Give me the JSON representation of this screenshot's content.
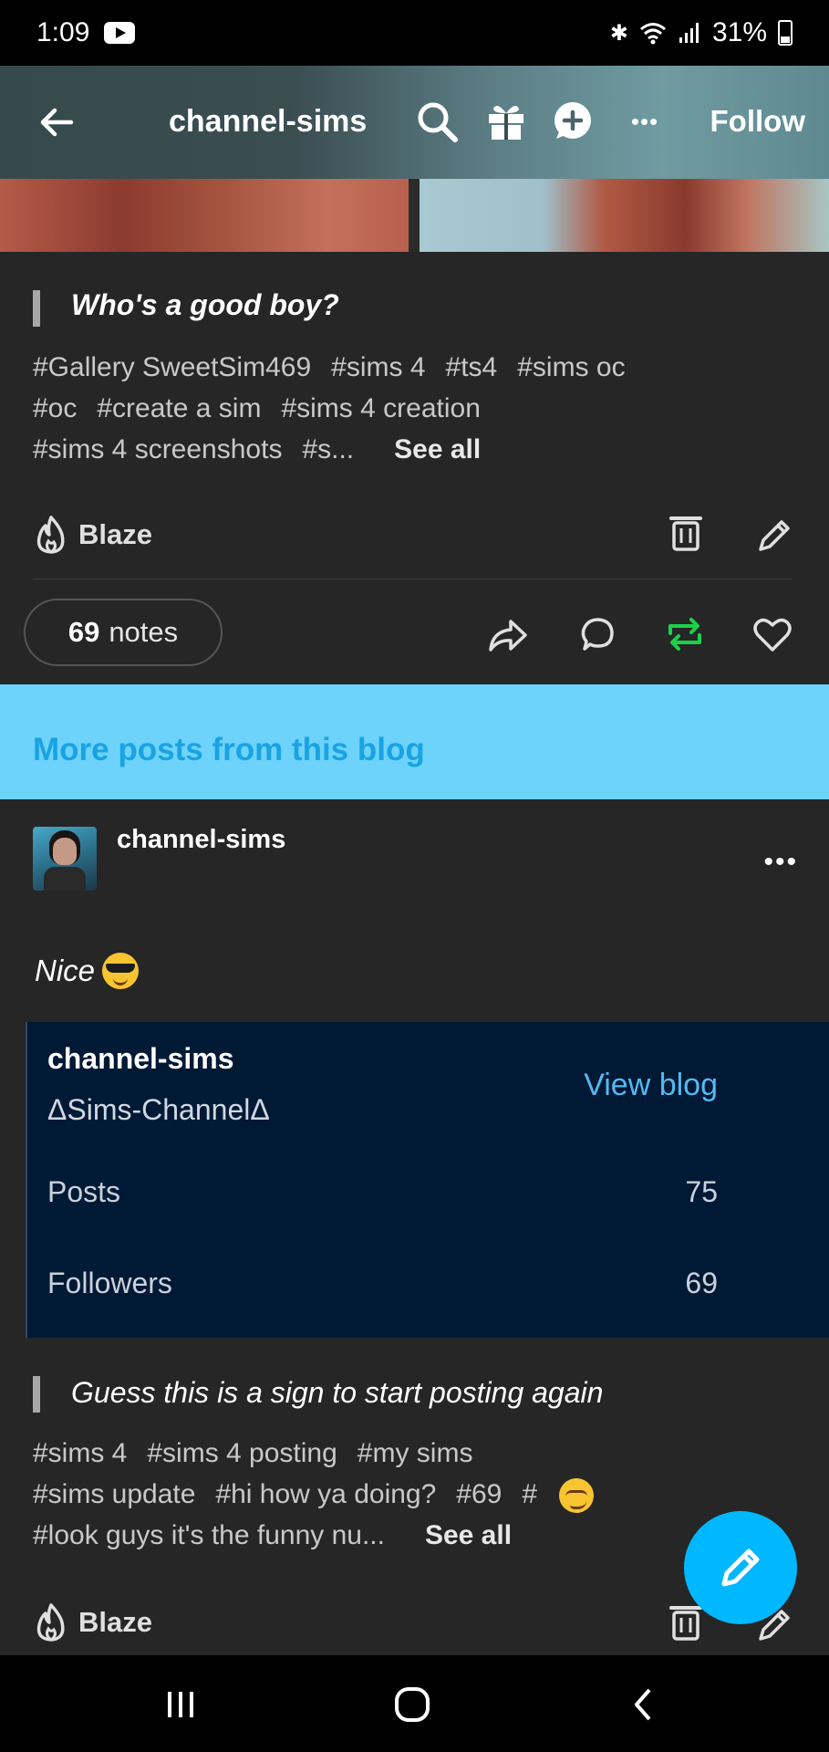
{
  "status_bar": {
    "time": "1:09",
    "battery": "31%"
  },
  "header": {
    "blog_name": "channel-sims",
    "follow_label": "Follow",
    "more_label": "•••"
  },
  "post": {
    "quote": "Who's a good boy?",
    "tags": [
      "#Gallery SweetSim469",
      "#sims 4",
      "#ts4",
      "#sims oc",
      "#oc",
      "#create a sim",
      "#sims 4 creation",
      "#sims 4 screenshots",
      "#s..."
    ],
    "see_all": "See all",
    "blaze_label": "Blaze",
    "notes_count": "69",
    "notes_label": "notes"
  },
  "more_posts_banner": "More posts from this blog",
  "post2": {
    "author": "channel-sims",
    "more_label": "•••",
    "text": "Nice",
    "blog_card": {
      "name": "channel-sims",
      "title": "ΔSims-ChannelΔ",
      "view_blog_label": "View blog",
      "posts_label": "Posts",
      "posts_value": "75",
      "followers_label": "Followers",
      "followers_value": "69"
    },
    "quote": "Guess this is a sign to start posting again",
    "tags": [
      "#sims 4",
      "#sims 4 posting",
      "#my sims",
      "#sims update",
      "#hi how ya doing?",
      "#69",
      "#",
      "#look guys it's the funny nu..."
    ],
    "see_all": "See all",
    "blaze_label": "Blaze"
  },
  "colors": {
    "accent_blue": "#00b8ff",
    "banner_blue": "#6dd3fb",
    "reblog_green": "#1bd14a",
    "card_bg": "#001935"
  }
}
